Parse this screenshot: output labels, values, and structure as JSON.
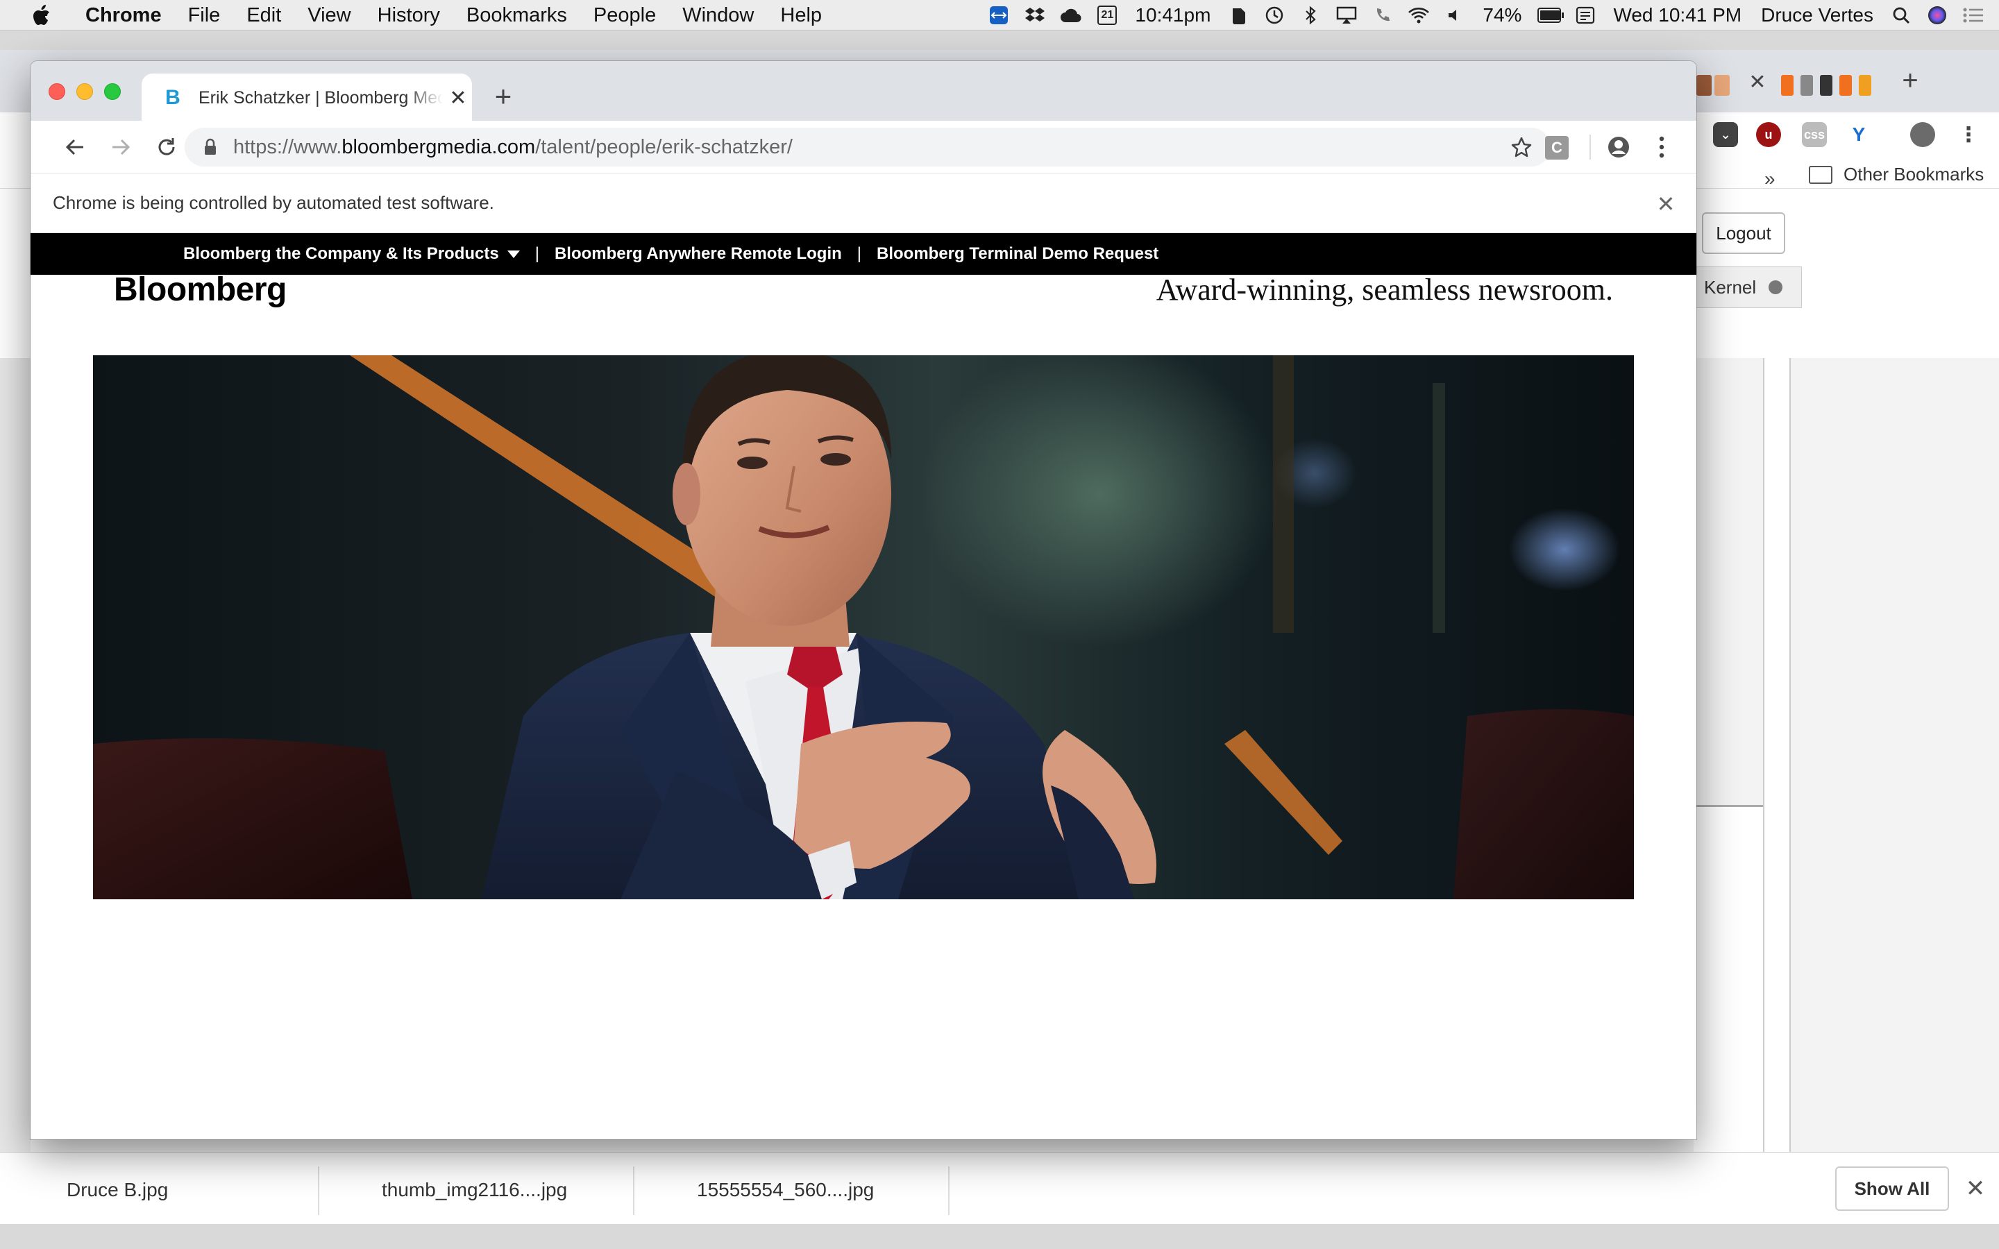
{
  "menubar": {
    "app_name": "Chrome",
    "items": [
      "File",
      "Edit",
      "View",
      "History",
      "Bookmarks",
      "People",
      "Window",
      "Help"
    ],
    "time_short": "10:41pm",
    "calendar_day": "21",
    "battery_percent": "74%",
    "clock": "Wed 10:41 PM",
    "user_name": "Druce Vertes"
  },
  "browser": {
    "tab_title": "Erik Schatzker | Bloomberg Media",
    "tab_favicon_letter": "B",
    "url_prefix": "https://www.",
    "url_host": "bloombergmedia.com",
    "url_path": "/talent/people/erik-schatzker/",
    "extension_letter": "C",
    "infobar_message": "Chrome is being controlled by automated test software."
  },
  "background_window": {
    "more_bookmarks": "»",
    "other_bookmarks": "Other Bookmarks",
    "logout_label": "Logout",
    "kernel_label": "Kernel"
  },
  "downloads": {
    "items": [
      "Druce B.jpg",
      "thumb_img2116....jpg",
      "15555554_560....jpg"
    ],
    "show_all_label": "Show All"
  },
  "page": {
    "nav": {
      "item1": "Bloomberg the Company & Its Products",
      "item2": "Bloomberg Anywhere Remote Login",
      "item3": "Bloomberg Terminal Demo Request",
      "separator": "|"
    },
    "brand": "Bloomberg",
    "tagline": "Award-winning, seamless newsroom."
  },
  "colors": {
    "nav_bg": "#000000",
    "favicon_blue": "#1d9ad6",
    "tie_red": "#c0152a",
    "suit_navy": "#1b2a4a"
  }
}
